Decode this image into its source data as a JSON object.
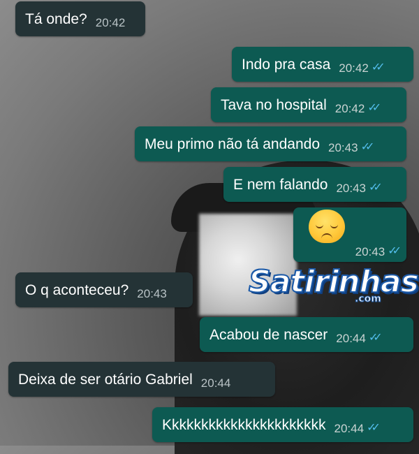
{
  "messages": [
    {
      "id": "m1",
      "dir": "in",
      "text": "Tá onde?",
      "time": "20:42"
    },
    {
      "id": "m2",
      "dir": "out",
      "text": "Indo pra casa",
      "time": "20:42",
      "ticks": "✓✓"
    },
    {
      "id": "m3",
      "dir": "out",
      "text": "Tava no hospital",
      "time": "20:42",
      "ticks": "✓✓"
    },
    {
      "id": "m4",
      "dir": "out",
      "text": "Meu primo não tá andando",
      "time": "20:43",
      "ticks": "✓✓"
    },
    {
      "id": "m5",
      "dir": "out",
      "text": "E nem falando",
      "time": "20:43",
      "ticks": "✓✓"
    },
    {
      "id": "m6",
      "dir": "out",
      "emoji": "pensive-face-emoji",
      "time": "20:43",
      "ticks": "✓✓"
    },
    {
      "id": "m7",
      "dir": "in",
      "text": "O q aconteceu?",
      "time": "20:43"
    },
    {
      "id": "m8",
      "dir": "out",
      "text": "Acabou de nascer",
      "time": "20:44",
      "ticks": "✓✓"
    },
    {
      "id": "m9",
      "dir": "in",
      "text": "Deixa de ser otário Gabriel",
      "time": "20:44"
    },
    {
      "id": "m10",
      "dir": "out",
      "text": "Kkkkkkkkkkkkkkkkkkkkkk",
      "time": "20:44",
      "ticks": "✓✓"
    }
  ],
  "watermark": {
    "text": "Satirinhas",
    "sub": ".com"
  },
  "colors": {
    "incoming": "#243336",
    "outgoing": "#0d5a52",
    "read_ticks": "#53bdeb"
  }
}
